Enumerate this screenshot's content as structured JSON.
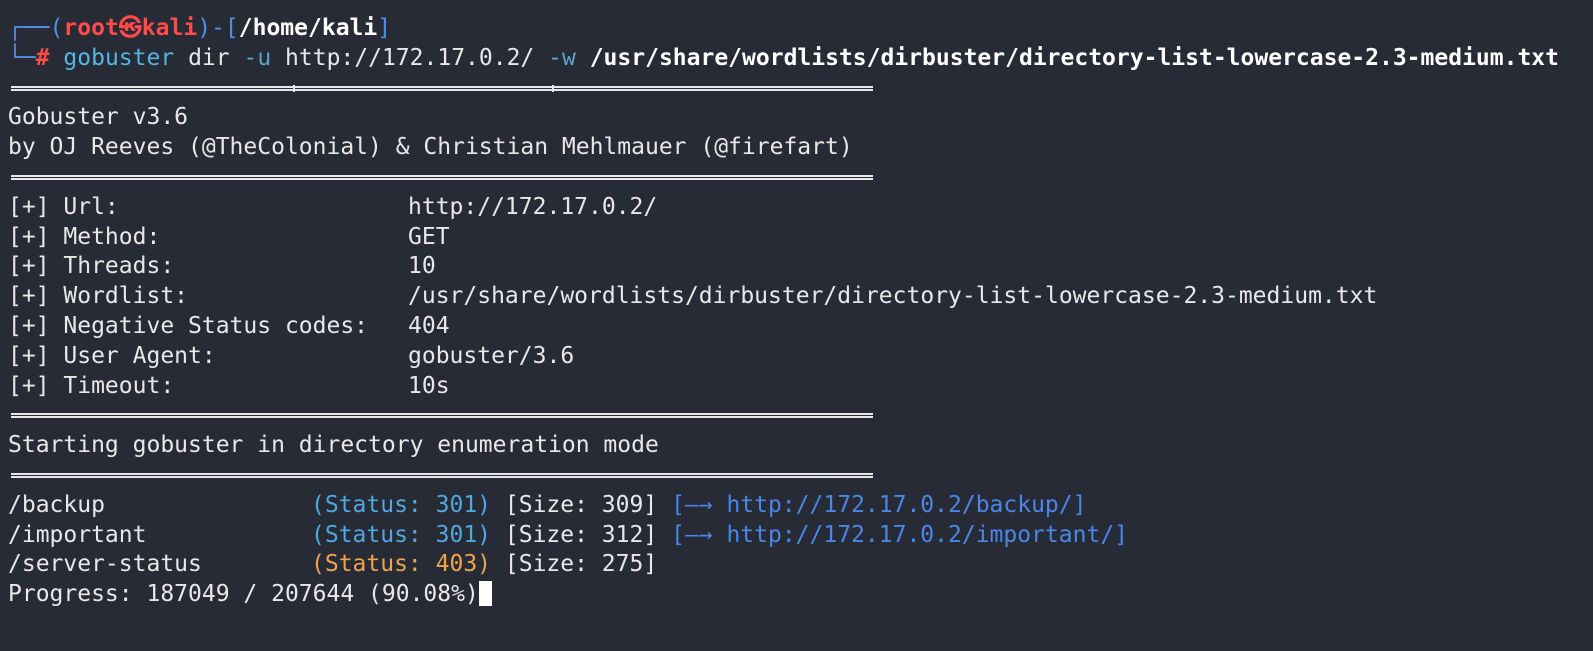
{
  "prompt": {
    "corner_top": "┌──",
    "open_paren": "(",
    "user": "root",
    "at_symbol": "㉿",
    "host": "kali",
    "close_paren": ")",
    "dash": "-",
    "open_bracket": "[",
    "cwd": "/home/kali",
    "close_bracket": "]",
    "corner_bottom": "└─",
    "hash": "#"
  },
  "command": {
    "program": "gobuster",
    "subcommand": "dir",
    "url_flag": "-u",
    "url": "http://172.17.0.2/",
    "wordlist_flag": "-w",
    "wordlist": "/usr/share/wordlists/dirbuster/directory-list-lowercase-2.3-medium.txt"
  },
  "banner": {
    "version": "Gobuster v3.6",
    "authors": "by OJ Reeves (@TheColonial) & Christian Mehlmauer (@firefart)"
  },
  "config": [
    {
      "label": "[+] Url:",
      "value": "http://172.17.0.2/"
    },
    {
      "label": "[+] Method:",
      "value": "GET"
    },
    {
      "label": "[+] Threads:",
      "value": "10"
    },
    {
      "label": "[+] Wordlist:",
      "value": "/usr/share/wordlists/dirbuster/directory-list-lowercase-2.3-medium.txt"
    },
    {
      "label": "[+] Negative Status codes:",
      "value": "404"
    },
    {
      "label": "[+] User Agent:",
      "value": "gobuster/3.6"
    },
    {
      "label": "[+] Timeout:",
      "value": "10s"
    }
  ],
  "start_message": "Starting gobuster in directory enumeration mode",
  "results": [
    {
      "path": "/backup",
      "status": "(Status: 301)",
      "size": "[Size: 309]",
      "redirect": "[—→ http://172.17.0.2/backup/]"
    },
    {
      "path": "/important",
      "status": "(Status: 301)",
      "size": "[Size: 312]",
      "redirect": "[—→ http://172.17.0.2/important/]"
    },
    {
      "path": "/server-status",
      "status": "(Status: 403)",
      "size": "[Size: 275]",
      "redirect": ""
    }
  ],
  "progress": "Progress: 187049 / 207644 (90.08%)",
  "colors": {
    "background": "#272b36",
    "foreground": "#e8e8e8",
    "prompt_blue": "#4f8fe8",
    "prompt_red": "#ff4a4a",
    "status_301": "#4fa8e0",
    "status_403": "#f0a44a",
    "link": "#4a86e8"
  }
}
